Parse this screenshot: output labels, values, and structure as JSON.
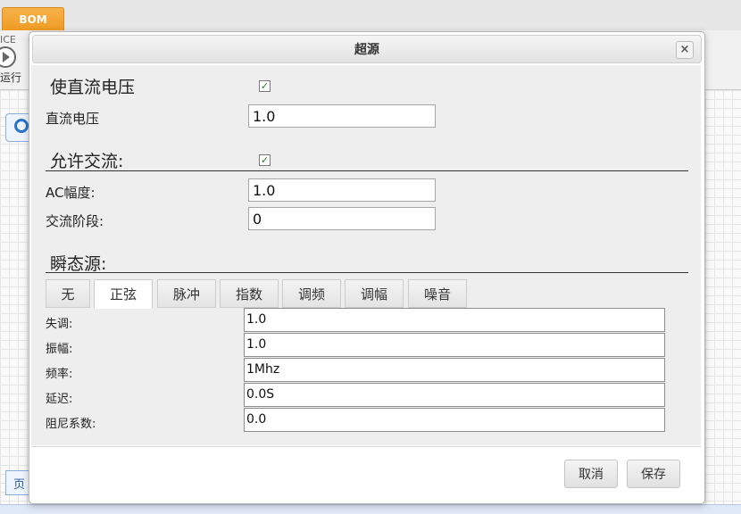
{
  "app": {
    "bom_tab": "BOM",
    "toolbar_fragment_1": "ICE",
    "toolbar_fragment_2": "运行",
    "page_fragment": "页"
  },
  "dialog": {
    "title": "超源",
    "close_glyph": "×",
    "dc_enable_label": "使直流电压",
    "dc_enable_checked": true,
    "dc_voltage_label": "直流电压",
    "dc_voltage_value": "1.0",
    "ac_enable_label": "允许交流:",
    "ac_enable_checked": true,
    "ac_magnitude_label": "AC幅度:",
    "ac_magnitude_value": "1.0",
    "ac_phase_label": "交流阶段:",
    "ac_phase_value": "0",
    "transient_label": "瞬态源:",
    "tabs": [
      {
        "label": "无",
        "active": false
      },
      {
        "label": "正弦",
        "active": true
      },
      {
        "label": "脉冲",
        "active": false
      },
      {
        "label": "指数",
        "active": false
      },
      {
        "label": "调频",
        "active": false
      },
      {
        "label": "调幅",
        "active": false
      },
      {
        "label": "噪音",
        "active": false
      }
    ],
    "params": [
      {
        "label": "失调:",
        "value": "1.0"
      },
      {
        "label": "振幅:",
        "value": "1.0"
      },
      {
        "label": "频率:",
        "value": "1Mhz"
      },
      {
        "label": "延迟:",
        "value": "0.0S"
      },
      {
        "label": "阻尼系数:",
        "value": "0.0"
      }
    ],
    "cancel_label": "取消",
    "save_label": "保存"
  },
  "colors": {
    "accent_tab": "#ee9a22",
    "checkbox_check": "#2b7a2b"
  }
}
